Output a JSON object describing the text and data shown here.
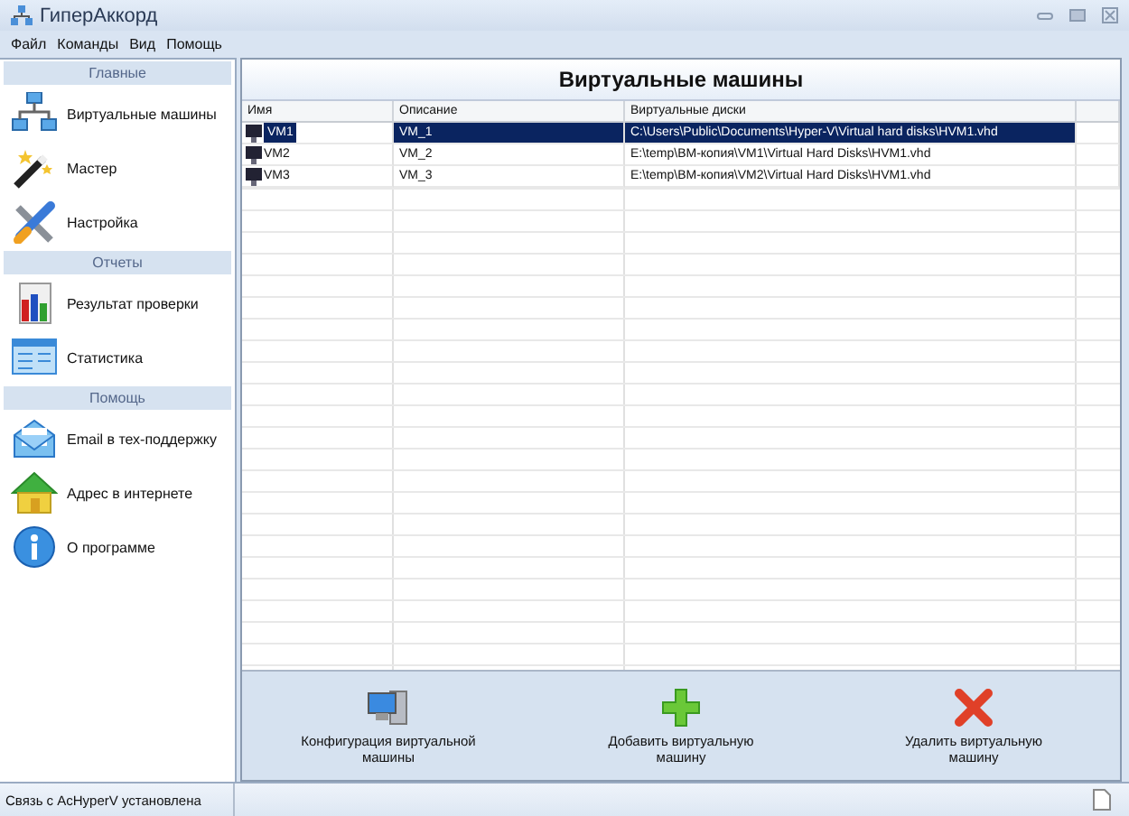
{
  "window": {
    "title": "ГиперАккорд"
  },
  "menu": [
    "Файл",
    "Команды",
    "Вид",
    "Помощь"
  ],
  "sidebar": [
    {
      "header": "Главные",
      "items": [
        {
          "label": "Виртуальные машины"
        },
        {
          "label": "Мастер"
        },
        {
          "label": "Настройка"
        }
      ]
    },
    {
      "header": "Отчеты",
      "items": [
        {
          "label": "Результат проверки"
        },
        {
          "label": "Статистика"
        }
      ]
    },
    {
      "header": "Помощь",
      "items": [
        {
          "label": "Email в тех-поддержку"
        },
        {
          "label": "Адрес в интернете"
        },
        {
          "label": "О программе"
        }
      ]
    }
  ],
  "panel": {
    "title": "Виртуальные машины"
  },
  "table": {
    "columns": [
      "Имя",
      "Описание",
      "Виртуальные диски"
    ],
    "rows": [
      {
        "name": "VM1",
        "description": "VM_1",
        "disks": "C:\\Users\\Public\\Documents\\Hyper-V\\Virtual hard disks\\HVM1.vhd",
        "selected": true
      },
      {
        "name": "VM2",
        "description": "VM_2",
        "disks": "E:\\temp\\ВМ-копия\\VM1\\Virtual Hard Disks\\HVM1.vhd",
        "selected": false
      },
      {
        "name": "VM3",
        "description": "VM_3",
        "disks": "E:\\temp\\ВМ-копия\\VM2\\Virtual Hard Disks\\HVM1.vhd",
        "selected": false
      }
    ]
  },
  "actions": [
    {
      "label": "Конфигурация виртуальной машины"
    },
    {
      "label": "Добавить виртуальную машину"
    },
    {
      "label": "Удалить виртуальную машину"
    }
  ],
  "status_bar": {
    "text": "Связь с AcHyperV установлена"
  }
}
